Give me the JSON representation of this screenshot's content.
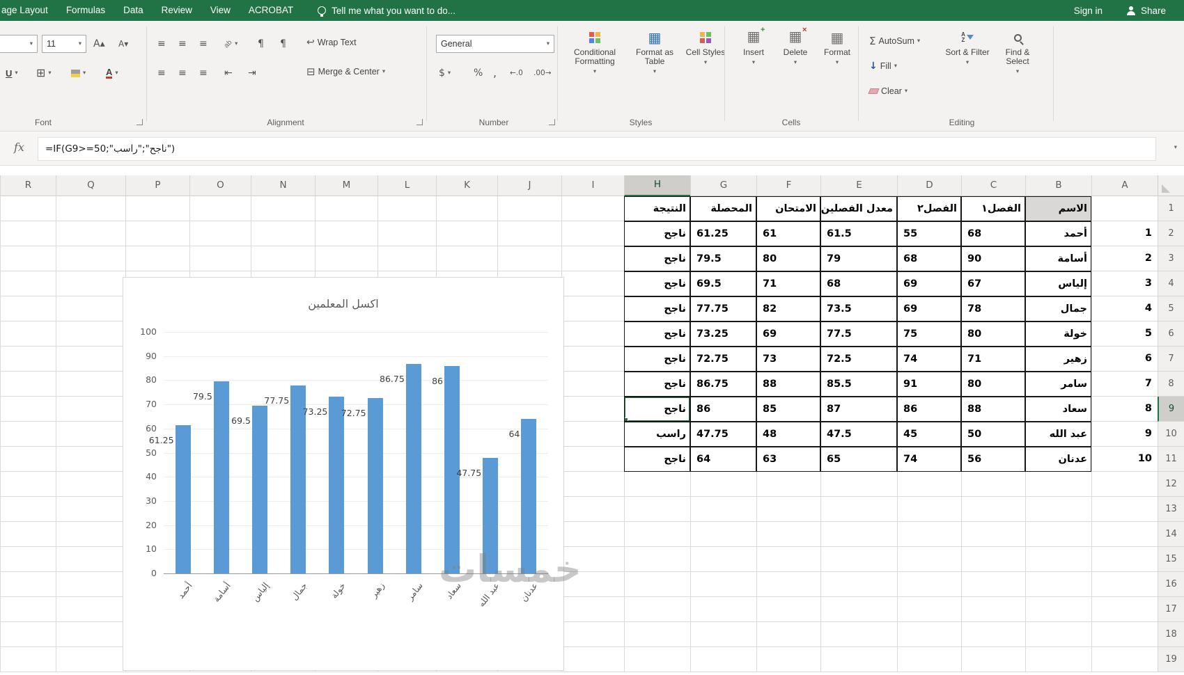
{
  "titlebar": {
    "tabs": [
      "age Layout",
      "Formulas",
      "Data",
      "Review",
      "View",
      "ACROBAT"
    ],
    "tell_me": "Tell me what you want to do...",
    "sign_in": "Sign in",
    "share": "Share"
  },
  "ribbon": {
    "font": {
      "label": "Font",
      "size": "11"
    },
    "alignment": {
      "label": "Alignment",
      "wrap_text": "Wrap Text",
      "merge_center": "Merge & Center"
    },
    "number": {
      "label": "Number",
      "format": "General"
    },
    "styles": {
      "label": "Styles",
      "conditional": "Conditional Formatting",
      "format_table": "Format as Table",
      "cell_styles": "Cell Styles"
    },
    "cells": {
      "label": "Cells",
      "insert": "Insert",
      "delete": "Delete",
      "format": "Format"
    },
    "editing": {
      "label": "Editing",
      "autosum": "AutoSum",
      "fill": "Fill",
      "clear": "Clear",
      "sort_filter": "Sort & Filter",
      "find_select": "Find & Select"
    }
  },
  "formula_bar": {
    "fx": "fx",
    "formula": "=IF(G9>=50;\"ناجح\";\"راسب\")"
  },
  "sheet": {
    "columns": [
      "A",
      "B",
      "C",
      "D",
      "E",
      "F",
      "G",
      "H",
      "I",
      "J",
      "K",
      "L",
      "M",
      "N",
      "O",
      "P",
      "Q",
      "R"
    ],
    "visible_rows": 19,
    "selection": {
      "cell": "H9",
      "column": "H",
      "row": 9
    }
  },
  "table": {
    "headers": {
      "name": "الاسم",
      "sem1": "الفصل١",
      "sem2": "الفصل٢",
      "avg": "معدل الفصلين",
      "exam": "الامتحان",
      "total": "المحصلة",
      "result": "النتيجة"
    },
    "rows": [
      {
        "serial": "1",
        "name": "أحمد",
        "sem1": "68",
        "sem2": "55",
        "avg": "61.5",
        "exam": "61",
        "total": "61.25",
        "result": "ناجح"
      },
      {
        "serial": "2",
        "name": "أسامة",
        "sem1": "90",
        "sem2": "68",
        "avg": "79",
        "exam": "80",
        "total": "79.5",
        "result": "ناجح"
      },
      {
        "serial": "3",
        "name": "إلياس",
        "sem1": "67",
        "sem2": "69",
        "avg": "68",
        "exam": "71",
        "total": "69.5",
        "result": "ناجح"
      },
      {
        "serial": "4",
        "name": "جمال",
        "sem1": "78",
        "sem2": "69",
        "avg": "73.5",
        "exam": "82",
        "total": "77.75",
        "result": "ناجح"
      },
      {
        "serial": "5",
        "name": "خولة",
        "sem1": "80",
        "sem2": "75",
        "avg": "77.5",
        "exam": "69",
        "total": "73.25",
        "result": "ناجح"
      },
      {
        "serial": "6",
        "name": "زهير",
        "sem1": "71",
        "sem2": "74",
        "avg": "72.5",
        "exam": "73",
        "total": "72.75",
        "result": "ناجح"
      },
      {
        "serial": "7",
        "name": "سامر",
        "sem1": "80",
        "sem2": "91",
        "avg": "85.5",
        "exam": "88",
        "total": "86.75",
        "result": "ناجح"
      },
      {
        "serial": "8",
        "name": "سعاد",
        "sem1": "88",
        "sem2": "86",
        "avg": "87",
        "exam": "85",
        "total": "86",
        "result": "ناجح"
      },
      {
        "serial": "9",
        "name": "عبد الله",
        "sem1": "50",
        "sem2": "45",
        "avg": "47.5",
        "exam": "48",
        "total": "47.75",
        "result": "راسب"
      },
      {
        "serial": "10",
        "name": "عدنان",
        "sem1": "56",
        "sem2": "74",
        "avg": "65",
        "exam": "63",
        "total": "64",
        "result": "ناجح"
      }
    ]
  },
  "chart_data": {
    "type": "bar",
    "title": "اكسل المعلمين",
    "categories": [
      "أحمد",
      "أسامة",
      "إلياس",
      "جمال",
      "خولة",
      "زهير",
      "سامر",
      "سعاد",
      "عبد الله",
      "عدنان"
    ],
    "values": [
      61.25,
      79.5,
      69.5,
      77.75,
      73.25,
      72.75,
      86.75,
      86,
      47.75,
      64
    ],
    "xlabel": "",
    "ylabel": "",
    "ylim": [
      0,
      100
    ],
    "ytick_step": 10,
    "grid": true,
    "legend": "none",
    "bar_color": "#5b9bd5"
  },
  "watermark": "خمسات",
  "colors": {
    "brand_green": "#217346",
    "selection_green": "#217346",
    "bar_blue": "#5b9bd5"
  },
  "icons": {
    "chevron": "▾",
    "align": "≡",
    "indent_left": "⇤",
    "indent_right": "⇥",
    "pilcrow": "¶",
    "wrap_return": "↩",
    "merge": "⊟",
    "borders": "⊞",
    "grid": "▦",
    "sigma": "Σ",
    "arrow_down": "↓",
    "a_up": "A▴",
    "a_down": "A▾",
    "underline": "U",
    "font_color": "A",
    "currency": "$",
    "percent": "%",
    "comma": ",",
    "inc_decimal": "←.0",
    "dec_decimal": ".00→",
    "orientation": "ab",
    "sort_a": "A",
    "sort_z": "Z",
    "fx_expand": "▾"
  }
}
